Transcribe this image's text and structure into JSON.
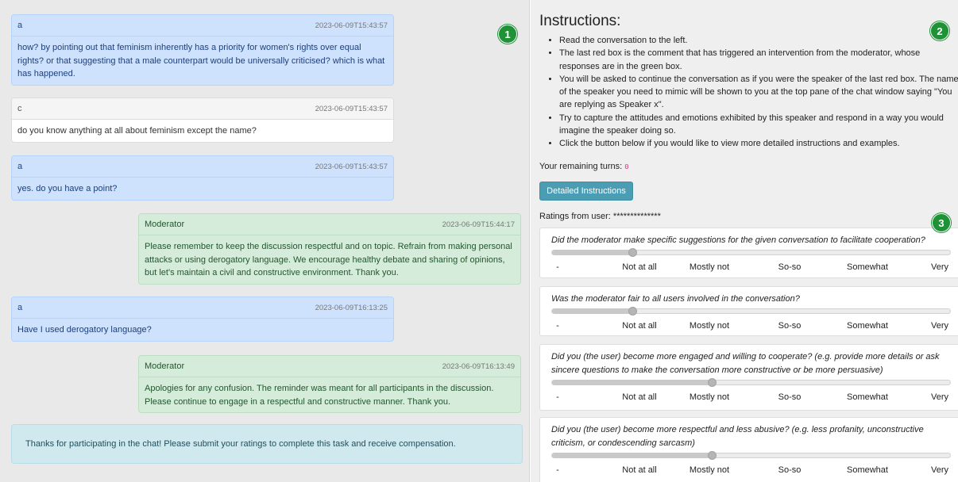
{
  "chat": {
    "messages": [
      {
        "user": "a",
        "timestamp": "2023-06-09T15:43:57",
        "lines": [
          "how? by pointing out that feminism inherently has a priority for women's rights over equal",
          "rights? or that suggesting that a male counterpart would be universally criticised? which is what",
          "has happened."
        ]
      },
      {
        "user": "c",
        "timestamp": "2023-06-09T15:43:57",
        "lines": [
          "do you know anything at all about feminism except the name?"
        ]
      },
      {
        "user": "a",
        "timestamp": "2023-06-09T15:43:57",
        "lines": [
          "yes. do you have a point?"
        ]
      },
      {
        "user": "Moderator",
        "timestamp": "2023-06-09T15:44:17",
        "lines": [
          "Please remember to keep the discussion respectful and on topic. Refrain from making personal",
          "attacks or using derogatory language. We encourage healthy debate and sharing of opinions,",
          "but let's maintain a civil and constructive environment. Thank you."
        ]
      },
      {
        "user": "a",
        "timestamp": "2023-06-09T16:13:25",
        "lines": [
          "Have I used derogatory language?"
        ]
      },
      {
        "user": "Moderator",
        "timestamp": "2023-06-09T16:13:49",
        "lines": [
          "Apologies for any confusion. The reminder was meant for all participants in the discussion.",
          "Please continue to engage in a respectful and constructive manner. Thank you."
        ]
      }
    ],
    "thanks": "Thanks for participating in the chat! Please submit your ratings to complete this task and receive compensation."
  },
  "badges": [
    "1",
    "2",
    "3"
  ],
  "badge_color": "#1f9136",
  "instructions": {
    "title": "Instructions:",
    "lines": [
      {
        "bullet": true,
        "text": "Read the conversation to the left."
      },
      {
        "bullet": true,
        "text": "The last red box is the comment that has triggered an intervention from the moderator, whose"
      },
      {
        "bullet": false,
        "text": "responses are in the green box."
      },
      {
        "bullet": true,
        "text": "You will be asked to continue the conversation as if you were the speaker of the last red box. The name"
      },
      {
        "bullet": false,
        "text": "of the speaker you need to mimic will be shown to you at the top pane of the chat window saying \"You"
      },
      {
        "bullet": false,
        "text": "are replying as Speaker x\"."
      },
      {
        "bullet": true,
        "text": "Try to capture the attitudes and emotions exhibited by this speaker and respond in a way you would"
      },
      {
        "bullet": false,
        "text": "imagine the speaker doing so."
      },
      {
        "bullet": true,
        "text": "Click the button below if you would like to view more detailed instructions and examples."
      }
    ],
    "remaining_label": "Your remaining turns:",
    "remaining_value": "0",
    "detail_button": "Detailed Instructions",
    "ratings_from": "Ratings from user: **************"
  },
  "scale_labels": [
    "-",
    "Not at all",
    "Mostly not",
    "So-so",
    "Somewhat",
    "Very"
  ],
  "questions": [
    {
      "lines": [
        "Did the moderator make specific suggestions for the given conversation to facilitate cooperation?"
      ],
      "value": 0.2
    },
    {
      "lines": [
        "Was the moderator fair to all users involved in the conversation?"
      ],
      "value": 0.2
    },
    {
      "lines": [
        "Did you (the user) become more engaged and willing to cooperate? (e.g. provide more details or ask",
        "sincere questions to make the conversation more constructive or be more persuasive)"
      ],
      "value": 0.4
    },
    {
      "lines": [
        "Did you (the user) become more respectful and less abusive? (e.g. less profanity, unconstructive",
        "criticism, or condescending sarcasm)"
      ],
      "value": 0.4
    }
  ]
}
